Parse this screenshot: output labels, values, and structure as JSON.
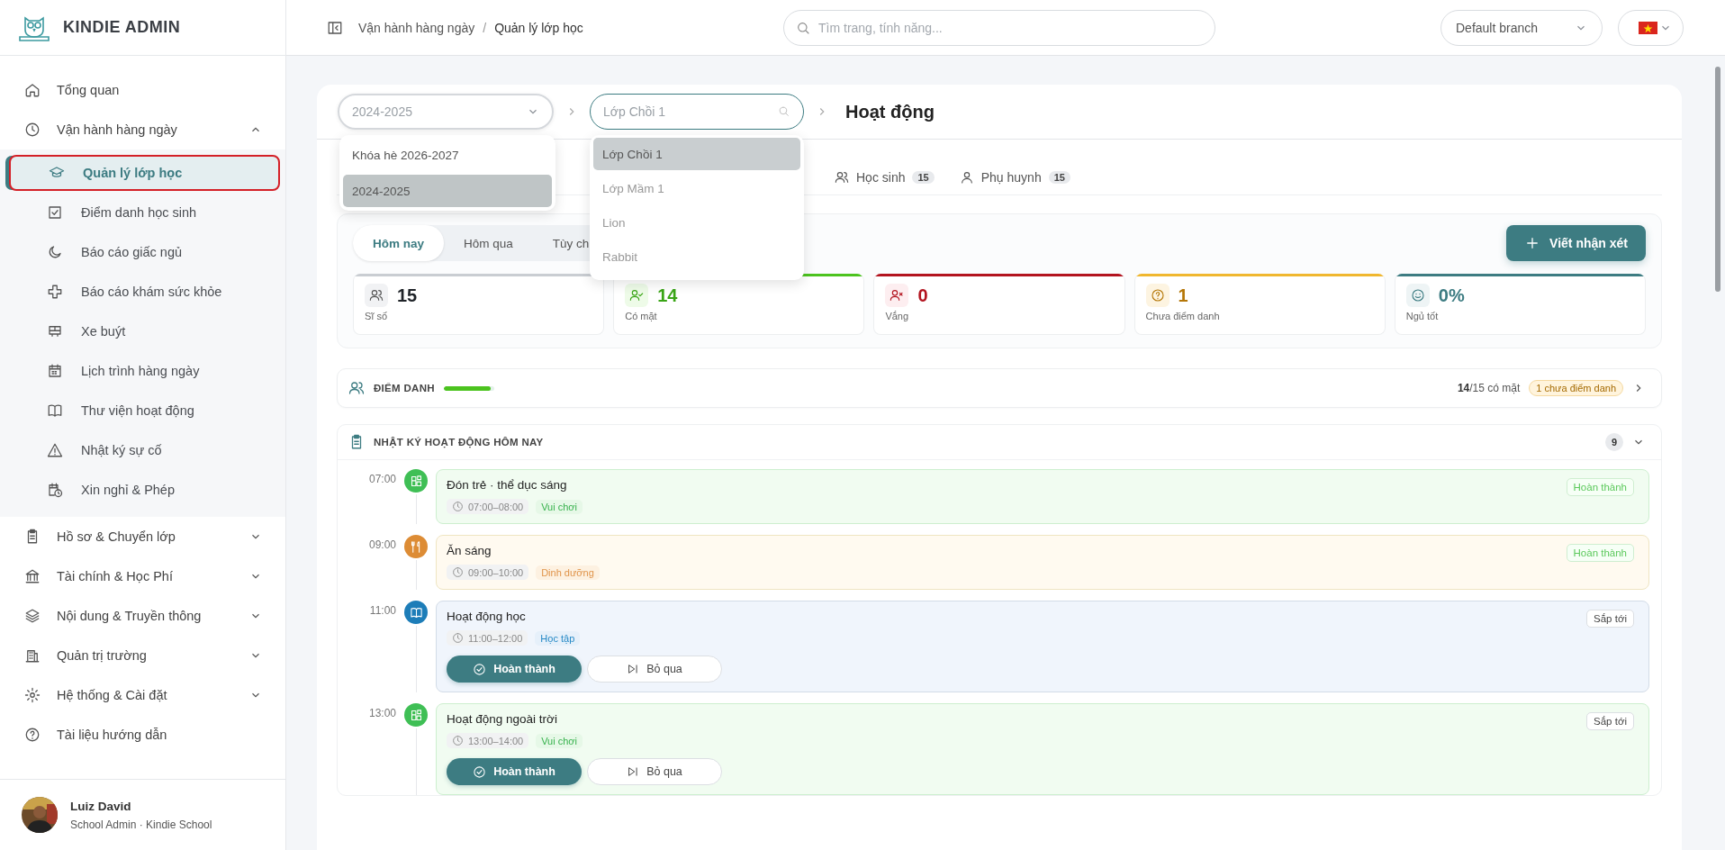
{
  "brand": {
    "name": "KINDIE ADMIN"
  },
  "sidebar": {
    "items": [
      {
        "kind": "link",
        "label": "Tổng quan"
      },
      {
        "kind": "group",
        "label": "Vận hành hàng ngày",
        "expanded": true,
        "children": [
          {
            "label": "Quản lý lớp học",
            "selected": true
          },
          {
            "label": "Điểm danh học sinh",
            "selected": false
          },
          {
            "label": "Báo cáo giấc ngủ",
            "selected": false
          },
          {
            "label": "Báo cáo khám sức khỏe",
            "selected": false
          },
          {
            "label": "Xe buýt",
            "selected": false
          },
          {
            "label": "Lịch trình hàng ngày",
            "selected": false
          },
          {
            "label": "Thư viện hoạt động",
            "selected": false
          },
          {
            "label": "Nhật ký sự cố",
            "selected": false
          },
          {
            "label": "Xin nghỉ & Phép",
            "selected": false
          }
        ]
      },
      {
        "kind": "group",
        "label": "Hồ sơ & Chuyển lớp",
        "expanded": false
      },
      {
        "kind": "group",
        "label": "Tài chính & Học Phí",
        "expanded": false
      },
      {
        "kind": "group",
        "label": "Nội dung & Truyền thông",
        "expanded": false
      },
      {
        "kind": "group",
        "label": "Quản trị trường",
        "expanded": false
      },
      {
        "kind": "group",
        "label": "Hệ thống & Cài đặt",
        "expanded": false
      },
      {
        "kind": "link",
        "label": "Tài liệu hướng dẫn"
      }
    ]
  },
  "user": {
    "name": "Luiz David",
    "role": "School Admin · Kindie School"
  },
  "header": {
    "breadcrumb": [
      "Vận hành hàng ngày",
      "Quản lý lớp học"
    ],
    "breadcrumb_separator": "/",
    "search": {
      "placeholder": "Tìm trang, tính năng..."
    },
    "branch_select": {
      "value": "Default branch"
    }
  },
  "filters": {
    "year_select": {
      "placeholder": "2024-2025",
      "options": [
        {
          "label": "Khóa hè 2026-2027",
          "selected": false
        },
        {
          "label": "2024-2025",
          "selected": true
        }
      ]
    },
    "class_select": {
      "placeholder": "Lớp Chồi 1",
      "options": [
        {
          "label": "Lớp Chồi 1",
          "selected": true
        },
        {
          "label": "Lớp Mầm 1",
          "selected": false
        },
        {
          "label": "Lion",
          "selected": false
        },
        {
          "label": "Rabbit",
          "selected": false
        }
      ]
    },
    "page_title": "Hoạt động"
  },
  "tabs": [
    {
      "label": "Học sinh",
      "count": "15",
      "selected": false
    },
    {
      "label": "Phụ huynh",
      "count": "15",
      "selected": false
    }
  ],
  "range_tabs": [
    {
      "label": "Hôm nay",
      "selected": true
    },
    {
      "label": "Hôm qua",
      "selected": false
    },
    {
      "label": "Tùy ch",
      "selected": false
    }
  ],
  "write_button": "Viết nhận xét",
  "stats": [
    {
      "value": "15",
      "label": "Sĩ số",
      "color": "#c9cdd2"
    },
    {
      "value": "14",
      "label": "Có mặt",
      "color": "#4cc31f"
    },
    {
      "value": "0",
      "label": "Vắng",
      "color": "#b3141f"
    },
    {
      "value": "1",
      "label": "Chưa điểm danh",
      "color": "#f0b72f"
    },
    {
      "value": "0%",
      "label": "Ngủ tốt",
      "color": "#3d7c82"
    }
  ],
  "attendance": {
    "title": "ĐIỂM DANH",
    "level": 0.93,
    "present": "14",
    "total": "/15 có mặt",
    "pending": "1 chưa điểm danh"
  },
  "activity_log": {
    "title": "NHẬT KÝ HOẠT ĐỘNG HÔM NAY",
    "count": "9",
    "expanded": true,
    "items": [
      {
        "time": "07:00",
        "kind": "play",
        "title": "Đón trẻ · thể dục sáng",
        "range": "07:00–08:00",
        "category": "Vui chơi",
        "completed": true,
        "status_label": "Hoàn thành"
      },
      {
        "time": "09:00",
        "kind": "meal",
        "title": "Ăn sáng",
        "range": "09:00–10:00",
        "category": "Dinh dưỡng",
        "completed": true,
        "status_label": "Hoàn thành"
      },
      {
        "time": "11:00",
        "kind": "study",
        "title": "Hoạt động học",
        "range": "11:00–12:00",
        "category": "Học tập",
        "completed": false,
        "status_label": "Sắp tới",
        "actions": [
          "Hoàn thành",
          "Bỏ qua"
        ]
      },
      {
        "time": "13:00",
        "kind": "play",
        "title": "Hoạt động ngoài trời",
        "range": "13:00–14:00",
        "category": "Vui chơi",
        "completed": false,
        "status_label": "Sắp tới",
        "actions": [
          "Hoàn thành",
          "Bỏ qua"
        ]
      }
    ]
  }
}
